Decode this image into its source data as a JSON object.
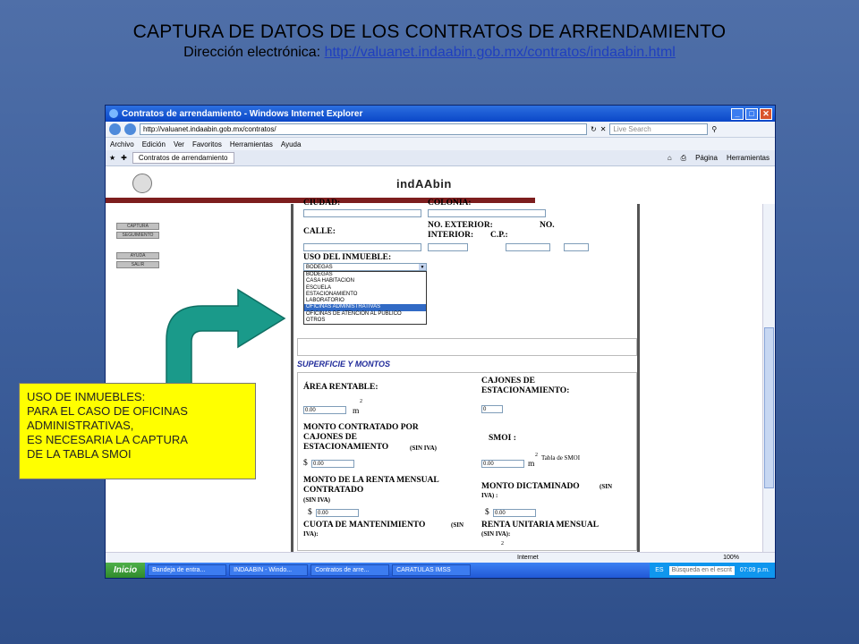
{
  "slide": {
    "title": "CAPTURA DE DATOS DE LOS CONTRATOS DE ARRENDAMIENTO",
    "subtitle_prefix": "Dirección electrónica: ",
    "subtitle_link": "http://valuanet.indaabin.gob.mx/contratos/indaabin.html"
  },
  "browser": {
    "window_title": "Contratos de arrendamiento - Windows Internet Explorer",
    "address": "http://valuanet.indaabin.gob.mx/contratos/",
    "search_placeholder": "Live Search",
    "menu": [
      "Archivo",
      "Edición",
      "Ver",
      "Favoritos",
      "Herramientas",
      "Ayuda"
    ],
    "tab_label": "Contratos de arrendamiento",
    "toolbar_right": [
      "Página",
      "Herramientas"
    ],
    "status_zone": "Internet",
    "zoom": "100%"
  },
  "page": {
    "brand": "indAAbin",
    "side_buttons": [
      "CAPTURA",
      "SEGUIMIENTO",
      "AYUDA",
      "SALIR"
    ]
  },
  "form": {
    "ciudad": "CIUDAD:",
    "colonia": "COLONIA:",
    "calle": "CALLE:",
    "no_exterior": "NO. EXTERIOR:",
    "no": "NO.",
    "interior": "INTERIOR:",
    "cp": "C.P.:",
    "uso_inmueble": "USO DEL INMUEBLE:",
    "uso_selected": "BODEGAS",
    "uso_options": [
      "BODEGAS",
      "CASA HABITACION",
      "ESCUELA",
      "ESTACIONAMIENTO",
      "LABORATORIO",
      "OFICINAS ADMINISTRATIVAS",
      "OFICINAS DE ATENCION AL PUBLICO",
      "OTROS"
    ],
    "section": "SUPERFICIE Y MONTOS",
    "area_rentable": "ÁREA RENTABLE:",
    "area_value": "0.00",
    "m2": "m",
    "sup2": "2",
    "cajones": "CAJONES DE",
    "cajones2": "ESTACIONAMIENTO:",
    "cajones_value": "0",
    "monto_contratado_1": "MONTO CONTRATADO POR",
    "monto_contratado_2": "CAJONES DE",
    "monto_contratado_3": "ESTACIONAMIENTO",
    "sin_iva": "(SIN IVA)",
    "smoi": "SMOI :",
    "tabla_smoi": "Tabla de SMOI",
    "dollar": "$",
    "monto_value": "0.00",
    "smoi_value": "0.00",
    "renta_mensual_1": "MONTO DE LA RENTA MENSUAL",
    "renta_mensual_2": "CONTRATADO",
    "renta_value": "0.00",
    "monto_dictaminado": "MONTO DICTAMINADO",
    "sin_iva_colon": "IVA) :",
    "sin_open": "(SIN",
    "dictaminado_value": "0.00",
    "cuota": "CUOTA DE MANTENIMIENTO",
    "cuota_sin": "(SIN",
    "iva": "IVA):",
    "renta_unitaria": "RENTA UNITARIA MENSUAL",
    "renta_unitaria_sin": "(SIN IVA):"
  },
  "taskbar": {
    "start": "Inicio",
    "tasks": [
      "Bandeja de entra...",
      "INDAABIN - Windo...",
      "Contratos de arre...",
      "CARATULAS IMSS"
    ],
    "lang": "ES",
    "search": "Búsqueda en el escrit",
    "clock": "07:09 p.m."
  },
  "callout": {
    "lines": [
      "USO DE INMUEBLES:",
      "PARA EL CASO DE OFICINAS",
      "ADMINISTRATIVAS,",
      "ES NECESARIA LA CAPTURA",
      "DE LA TABLA SMOI"
    ]
  },
  "colors": {
    "callout_bg": "#ffff00",
    "arrow": "#1a9a8a",
    "selected_option": "#316ac5"
  }
}
